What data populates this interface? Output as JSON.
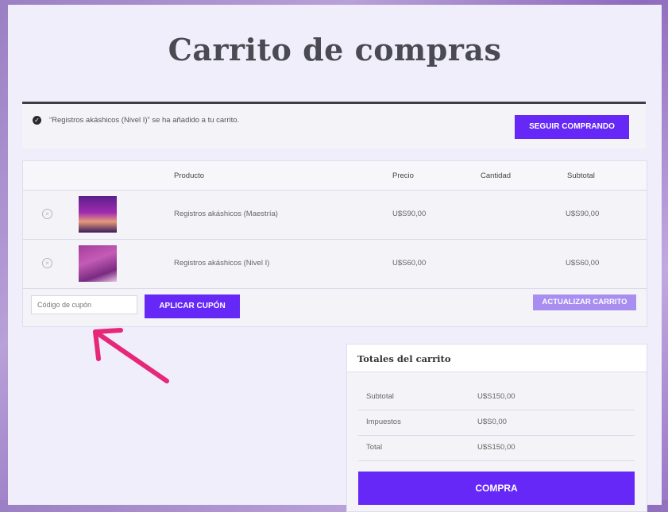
{
  "page": {
    "title": "Carrito de compras"
  },
  "notice": {
    "message": "“Registros akáshicos (Nivel I)” se ha añadido a tu carrito.",
    "button": "SEGUIR COMPRANDO"
  },
  "cart": {
    "headers": {
      "product": "Producto",
      "price": "Precio",
      "quantity": "Cantidad",
      "subtotal": "Subtotal"
    },
    "items": [
      {
        "name": "Registros akáshicos (Maestría)",
        "price": "U$S90,00",
        "subtotal": "U$S90,00"
      },
      {
        "name": "Registros akáshicos (Nivel I)",
        "price": "U$S60,00",
        "subtotal": "U$S60,00"
      }
    ],
    "coupon_placeholder": "Código de cupón",
    "apply_coupon": "APLICAR CUPÓN",
    "update_cart": "ACTUALIZAR CARRITO"
  },
  "totals": {
    "title": "Totales del carrito",
    "rows": [
      {
        "label": "Subtotal",
        "value": "U$S150,00"
      },
      {
        "label": "Impuestos",
        "value": "U$S0,00"
      },
      {
        "label": "Total",
        "value": "U$S150,00"
      }
    ],
    "checkout": "COMPRA"
  },
  "colors": {
    "accent": "#6528f7",
    "accent_light": "#a98ef2",
    "arrow": "#e6287a"
  },
  "icons": {
    "notice": "check-circle-icon",
    "remove": "remove-circle-icon",
    "annotation": "pink-arrow-icon"
  }
}
